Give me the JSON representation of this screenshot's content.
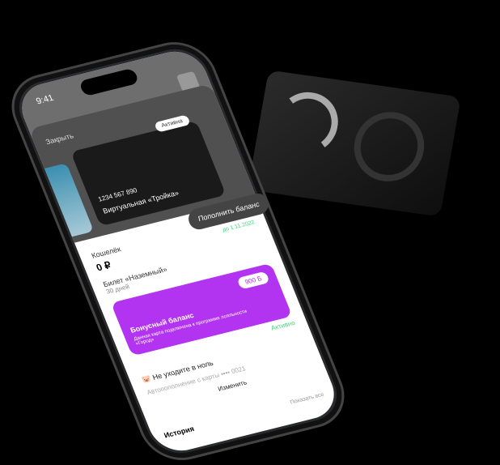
{
  "status": {
    "time": "9:41"
  },
  "sheet": {
    "close": "Закрыть",
    "badge": "Активна",
    "card_number": "1234 567 890",
    "card_name": "Виртуальная «Тройка»",
    "topup": "Пополнить баланс"
  },
  "wallet": {
    "label": "Кошелёк",
    "balance": "0 ₽"
  },
  "ticket": {
    "name": "Билет «Наземный»",
    "duration": "30 дней",
    "valid_until": "до 1.11.2022"
  },
  "bonus": {
    "points": "900 Б",
    "title": "Бонусный баланс",
    "description": "Данная карта подключена к программе лояльности «Город»",
    "status": "Активно"
  },
  "autopay": {
    "title": "Не уходите в ноль",
    "subtitle": "Автопополнение с карты •••• 0021",
    "change": "Изменить"
  },
  "history": {
    "title": "История",
    "show_all": "Показать все"
  },
  "colors": {
    "bonus": "#b233f0",
    "active": "#3ed67a"
  }
}
